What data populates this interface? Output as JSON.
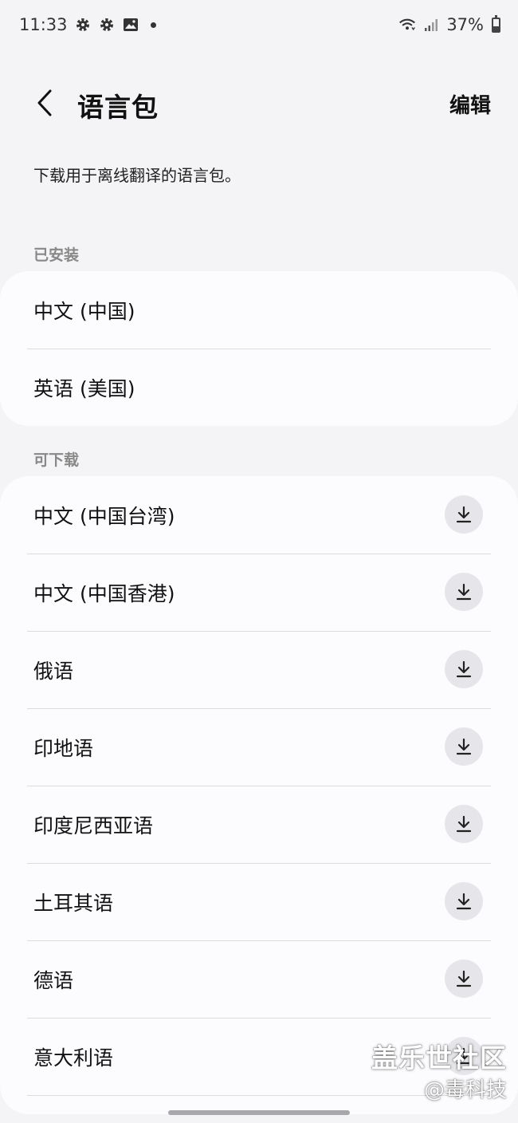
{
  "status_bar": {
    "time": "11:33",
    "left_icons": [
      "gear-icon",
      "gear-icon",
      "image-icon",
      "dot-icon"
    ],
    "right_icons": [
      "wifi-icon",
      "signal-icon",
      "battery-icon"
    ],
    "battery_percent": "37%"
  },
  "header": {
    "title": "语言包",
    "edit_label": "编辑"
  },
  "subtitle": "下载用于离线翻译的语言包。",
  "installed": {
    "label": "已安装",
    "items": [
      "中文 (中国)",
      "英语 (美国)"
    ]
  },
  "available": {
    "label": "可下载",
    "items": [
      "中文 (中国台湾)",
      "中文 (中国香港)",
      "俄语",
      "印地语",
      "印度尼西亚语",
      "土耳其语",
      "德语",
      "意大利语"
    ]
  },
  "watermark": {
    "brand": "盖乐世社区",
    "handle": "@毒科技"
  },
  "colors": {
    "background": "#f4f4f6",
    "card": "#fcfcfe",
    "download_button": "#e6e6ea",
    "section_label": "#888888"
  }
}
